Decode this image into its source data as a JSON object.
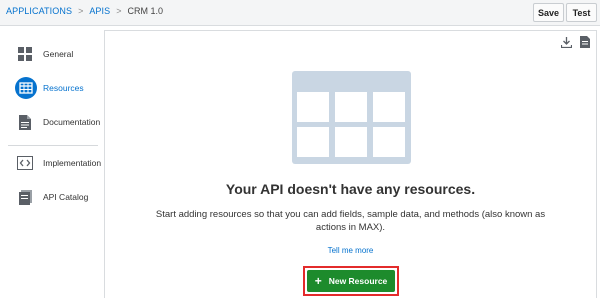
{
  "breadcrumb": {
    "applications": "APPLICATIONS",
    "apis": "APIS",
    "current": "CRM 1.0",
    "sep": ">"
  },
  "toolbar": {
    "save_label": "Save",
    "test_label": "Test"
  },
  "sidebar": {
    "items": [
      {
        "label": "General",
        "icon": "grid-icon"
      },
      {
        "label": "Resources",
        "icon": "table-icon",
        "active": true
      },
      {
        "label": "Documentation",
        "icon": "document-icon"
      },
      {
        "label": "Implementation",
        "icon": "code-icon"
      },
      {
        "label": "API Catalog",
        "icon": "catalog-icon"
      }
    ]
  },
  "main": {
    "empty_title": "Your API doesn't have any resources.",
    "empty_description": "Start adding resources so that you can add fields, sample data, and methods (also known as actions in MAX).",
    "tell_more": "Tell me more",
    "new_resource_label": "New Resource",
    "icons": [
      "download-icon",
      "export-document-icon"
    ]
  },
  "colors": {
    "accent": "#0572ce",
    "button_green": "#1d8b2c",
    "highlight_red": "#e32b2b",
    "placeholder_blue": "#c9d6e3"
  }
}
